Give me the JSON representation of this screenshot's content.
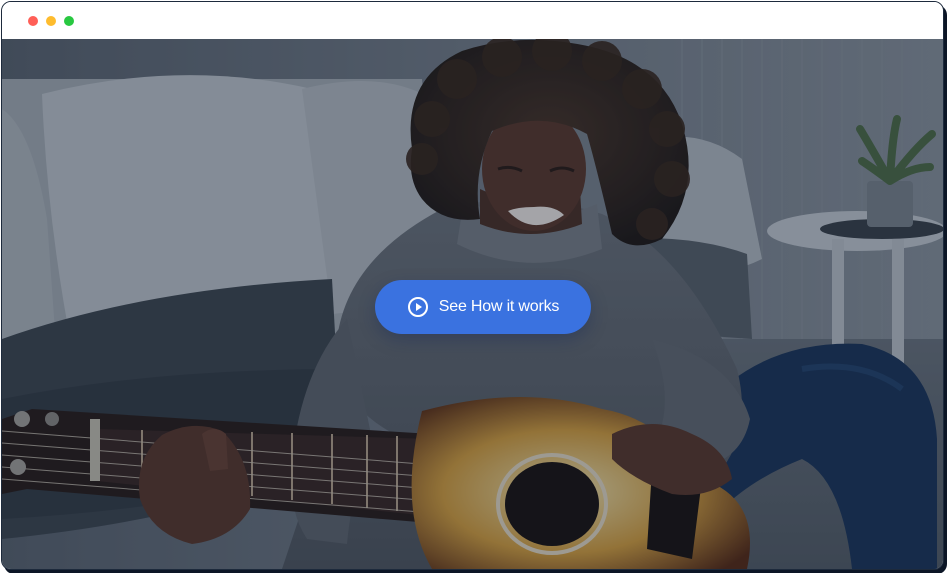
{
  "window": {
    "controls": [
      "close",
      "minimize",
      "maximize"
    ],
    "colors": {
      "close": "#ff5f57",
      "minimize": "#febc2e",
      "maximize": "#28c840"
    }
  },
  "hero": {
    "image_subject": "woman-playing-acoustic-guitar",
    "cta": {
      "label": "See How it works",
      "icon": "play-circle-icon",
      "color": "#3a72e0"
    }
  }
}
